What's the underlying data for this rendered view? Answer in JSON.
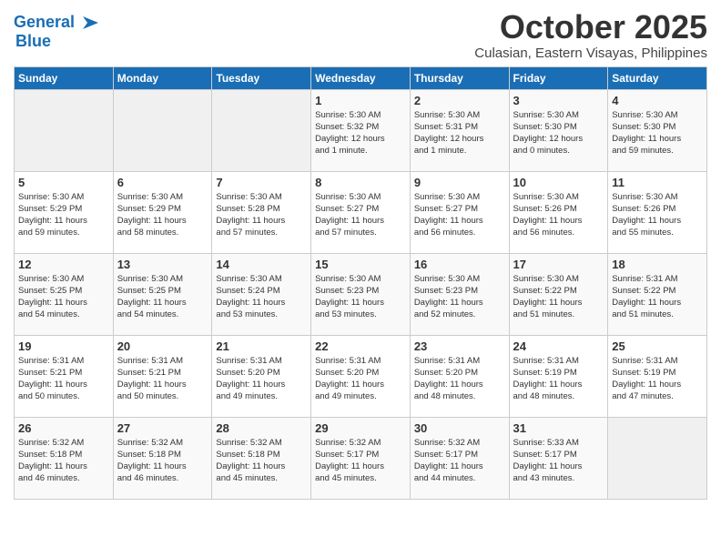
{
  "header": {
    "logo_line1": "General",
    "logo_line2": "Blue",
    "month": "October 2025",
    "location": "Culasian, Eastern Visayas, Philippines"
  },
  "weekdays": [
    "Sunday",
    "Monday",
    "Tuesday",
    "Wednesday",
    "Thursday",
    "Friday",
    "Saturday"
  ],
  "weeks": [
    [
      {
        "day": "",
        "info": ""
      },
      {
        "day": "",
        "info": ""
      },
      {
        "day": "",
        "info": ""
      },
      {
        "day": "1",
        "info": "Sunrise: 5:30 AM\nSunset: 5:32 PM\nDaylight: 12 hours\nand 1 minute."
      },
      {
        "day": "2",
        "info": "Sunrise: 5:30 AM\nSunset: 5:31 PM\nDaylight: 12 hours\nand 1 minute."
      },
      {
        "day": "3",
        "info": "Sunrise: 5:30 AM\nSunset: 5:30 PM\nDaylight: 12 hours\nand 0 minutes."
      },
      {
        "day": "4",
        "info": "Sunrise: 5:30 AM\nSunset: 5:30 PM\nDaylight: 11 hours\nand 59 minutes."
      }
    ],
    [
      {
        "day": "5",
        "info": "Sunrise: 5:30 AM\nSunset: 5:29 PM\nDaylight: 11 hours\nand 59 minutes."
      },
      {
        "day": "6",
        "info": "Sunrise: 5:30 AM\nSunset: 5:29 PM\nDaylight: 11 hours\nand 58 minutes."
      },
      {
        "day": "7",
        "info": "Sunrise: 5:30 AM\nSunset: 5:28 PM\nDaylight: 11 hours\nand 57 minutes."
      },
      {
        "day": "8",
        "info": "Sunrise: 5:30 AM\nSunset: 5:27 PM\nDaylight: 11 hours\nand 57 minutes."
      },
      {
        "day": "9",
        "info": "Sunrise: 5:30 AM\nSunset: 5:27 PM\nDaylight: 11 hours\nand 56 minutes."
      },
      {
        "day": "10",
        "info": "Sunrise: 5:30 AM\nSunset: 5:26 PM\nDaylight: 11 hours\nand 56 minutes."
      },
      {
        "day": "11",
        "info": "Sunrise: 5:30 AM\nSunset: 5:26 PM\nDaylight: 11 hours\nand 55 minutes."
      }
    ],
    [
      {
        "day": "12",
        "info": "Sunrise: 5:30 AM\nSunset: 5:25 PM\nDaylight: 11 hours\nand 54 minutes."
      },
      {
        "day": "13",
        "info": "Sunrise: 5:30 AM\nSunset: 5:25 PM\nDaylight: 11 hours\nand 54 minutes."
      },
      {
        "day": "14",
        "info": "Sunrise: 5:30 AM\nSunset: 5:24 PM\nDaylight: 11 hours\nand 53 minutes."
      },
      {
        "day": "15",
        "info": "Sunrise: 5:30 AM\nSunset: 5:23 PM\nDaylight: 11 hours\nand 53 minutes."
      },
      {
        "day": "16",
        "info": "Sunrise: 5:30 AM\nSunset: 5:23 PM\nDaylight: 11 hours\nand 52 minutes."
      },
      {
        "day": "17",
        "info": "Sunrise: 5:30 AM\nSunset: 5:22 PM\nDaylight: 11 hours\nand 51 minutes."
      },
      {
        "day": "18",
        "info": "Sunrise: 5:31 AM\nSunset: 5:22 PM\nDaylight: 11 hours\nand 51 minutes."
      }
    ],
    [
      {
        "day": "19",
        "info": "Sunrise: 5:31 AM\nSunset: 5:21 PM\nDaylight: 11 hours\nand 50 minutes."
      },
      {
        "day": "20",
        "info": "Sunrise: 5:31 AM\nSunset: 5:21 PM\nDaylight: 11 hours\nand 50 minutes."
      },
      {
        "day": "21",
        "info": "Sunrise: 5:31 AM\nSunset: 5:20 PM\nDaylight: 11 hours\nand 49 minutes."
      },
      {
        "day": "22",
        "info": "Sunrise: 5:31 AM\nSunset: 5:20 PM\nDaylight: 11 hours\nand 49 minutes."
      },
      {
        "day": "23",
        "info": "Sunrise: 5:31 AM\nSunset: 5:20 PM\nDaylight: 11 hours\nand 48 minutes."
      },
      {
        "day": "24",
        "info": "Sunrise: 5:31 AM\nSunset: 5:19 PM\nDaylight: 11 hours\nand 48 minutes."
      },
      {
        "day": "25",
        "info": "Sunrise: 5:31 AM\nSunset: 5:19 PM\nDaylight: 11 hours\nand 47 minutes."
      }
    ],
    [
      {
        "day": "26",
        "info": "Sunrise: 5:32 AM\nSunset: 5:18 PM\nDaylight: 11 hours\nand 46 minutes."
      },
      {
        "day": "27",
        "info": "Sunrise: 5:32 AM\nSunset: 5:18 PM\nDaylight: 11 hours\nand 46 minutes."
      },
      {
        "day": "28",
        "info": "Sunrise: 5:32 AM\nSunset: 5:18 PM\nDaylight: 11 hours\nand 45 minutes."
      },
      {
        "day": "29",
        "info": "Sunrise: 5:32 AM\nSunset: 5:17 PM\nDaylight: 11 hours\nand 45 minutes."
      },
      {
        "day": "30",
        "info": "Sunrise: 5:32 AM\nSunset: 5:17 PM\nDaylight: 11 hours\nand 44 minutes."
      },
      {
        "day": "31",
        "info": "Sunrise: 5:33 AM\nSunset: 5:17 PM\nDaylight: 11 hours\nand 43 minutes."
      },
      {
        "day": "",
        "info": ""
      }
    ]
  ]
}
